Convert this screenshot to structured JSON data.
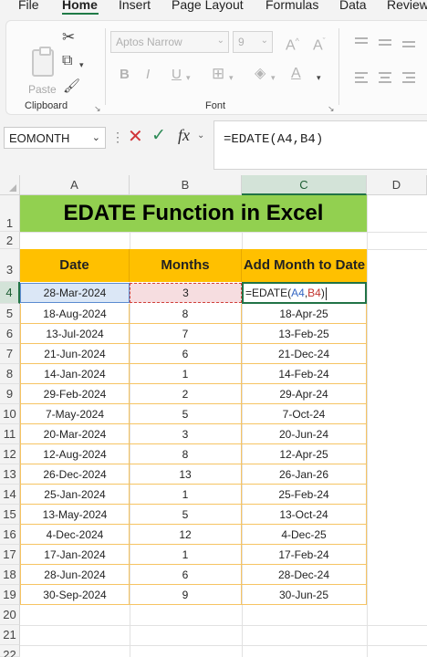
{
  "ribbon": {
    "tabs": [
      {
        "label": "File",
        "active": false
      },
      {
        "label": "Home",
        "active": true
      },
      {
        "label": "Insert",
        "active": false
      },
      {
        "label": "Page Layout",
        "active": false
      },
      {
        "label": "Formulas",
        "active": false
      },
      {
        "label": "Data",
        "active": false
      },
      {
        "label": "Review",
        "active": false
      }
    ],
    "clipboard": {
      "paste_label": "Paste",
      "group_label": "Clipboard"
    },
    "font": {
      "font_name": "Aptos Narrow",
      "font_size": "9",
      "bold": "B",
      "italic": "I",
      "underline": "U",
      "grow": "A^",
      "shrink": "Aˇ",
      "group_label": "Font"
    }
  },
  "formula_bar": {
    "name_box": "EOMONTH",
    "fx_label": "fx",
    "formula": "=EDATE(A4,B4)"
  },
  "sheet": {
    "columns": [
      "A",
      "B",
      "C",
      "D"
    ],
    "rows": [
      "1",
      "2",
      "3",
      "4",
      "5",
      "6",
      "7",
      "8",
      "9",
      "10",
      "11",
      "12",
      "13",
      "14",
      "15",
      "16",
      "17",
      "18",
      "19",
      "20",
      "21",
      "22"
    ],
    "active_cell": "C4",
    "title": "EDATE Function in Excel",
    "headers": [
      "Date",
      "Months",
      "Add Month to Date"
    ],
    "editing": {
      "prefix": "=EDATE(",
      "ref_a": "A4",
      "comma": ",",
      "ref_b": "B4",
      "suffix": ")"
    },
    "first_row": {
      "date": "28-Mar-2024",
      "months": "3"
    },
    "data_rows": [
      {
        "date": "18-Aug-2024",
        "months": "8",
        "result": "18-Apr-25"
      },
      {
        "date": "13-Jul-2024",
        "months": "7",
        "result": "13-Feb-25"
      },
      {
        "date": "21-Jun-2024",
        "months": "6",
        "result": "21-Dec-24"
      },
      {
        "date": "14-Jan-2024",
        "months": "1",
        "result": "14-Feb-24"
      },
      {
        "date": "29-Feb-2024",
        "months": "2",
        "result": "29-Apr-24"
      },
      {
        "date": "7-May-2024",
        "months": "5",
        "result": "7-Oct-24"
      },
      {
        "date": "20-Mar-2024",
        "months": "3",
        "result": "20-Jun-24"
      },
      {
        "date": "12-Aug-2024",
        "months": "8",
        "result": "12-Apr-25"
      },
      {
        "date": "26-Dec-2024",
        "months": "13",
        "result": "26-Jan-26"
      },
      {
        "date": "25-Jan-2024",
        "months": "1",
        "result": "25-Feb-24"
      },
      {
        "date": "13-May-2024",
        "months": "5",
        "result": "13-Oct-24"
      },
      {
        "date": "4-Dec-2024",
        "months": "12",
        "result": "4-Dec-25"
      },
      {
        "date": "17-Jan-2024",
        "months": "1",
        "result": "17-Feb-24"
      },
      {
        "date": "28-Jun-2024",
        "months": "6",
        "result": "28-Dec-24"
      },
      {
        "date": "30-Sep-2024",
        "months": "9",
        "result": "30-Jun-25"
      }
    ]
  },
  "colors": {
    "title_fill": "#92d050",
    "header_fill": "#ffc000",
    "selection": "#217346",
    "ref_a": "#3466c2",
    "ref_b": "#c2352f"
  }
}
